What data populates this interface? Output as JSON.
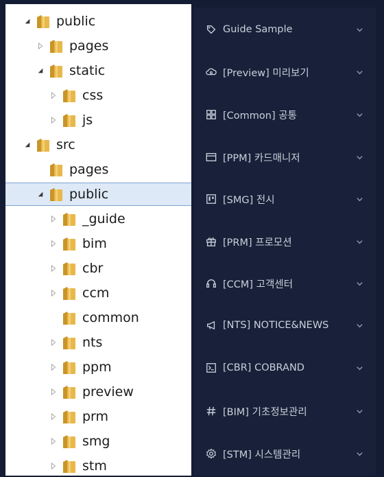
{
  "file_tree": {
    "nodes": [
      {
        "label": "public",
        "depth": 0,
        "toggle": "expanded"
      },
      {
        "label": "pages",
        "depth": 1,
        "toggle": "collapsed"
      },
      {
        "label": "static",
        "depth": 1,
        "toggle": "expanded"
      },
      {
        "label": "css",
        "depth": 2,
        "toggle": "collapsed"
      },
      {
        "label": "js",
        "depth": 2,
        "toggle": "collapsed"
      },
      {
        "label": "src",
        "depth": 0,
        "toggle": "expanded"
      },
      {
        "label": "pages",
        "depth": 1,
        "toggle": "none"
      },
      {
        "label": "public",
        "depth": 1,
        "toggle": "expanded",
        "selected": true
      },
      {
        "label": "_guide",
        "depth": 2,
        "toggle": "collapsed"
      },
      {
        "label": "bim",
        "depth": 2,
        "toggle": "collapsed"
      },
      {
        "label": "cbr",
        "depth": 2,
        "toggle": "collapsed"
      },
      {
        "label": "ccm",
        "depth": 2,
        "toggle": "collapsed"
      },
      {
        "label": "common",
        "depth": 2,
        "toggle": "none"
      },
      {
        "label": "nts",
        "depth": 2,
        "toggle": "collapsed"
      },
      {
        "label": "ppm",
        "depth": 2,
        "toggle": "collapsed"
      },
      {
        "label": "preview",
        "depth": 2,
        "toggle": "collapsed"
      },
      {
        "label": "prm",
        "depth": 2,
        "toggle": "collapsed"
      },
      {
        "label": "smg",
        "depth": 2,
        "toggle": "collapsed"
      },
      {
        "label": "stm",
        "depth": 2,
        "toggle": "collapsed"
      }
    ]
  },
  "side_menu": {
    "items": [
      {
        "label": "Guide Sample",
        "icon": "tag-icon"
      },
      {
        "label": "[Preview] 미리보기",
        "icon": "cloud-icon"
      },
      {
        "label": "[Common] 공통",
        "icon": "grid-icon"
      },
      {
        "label": "[PPM] 카드매니저",
        "icon": "card-icon"
      },
      {
        "label": "[SMG] 전시",
        "icon": "board-icon"
      },
      {
        "label": "[PRM] 프로모션",
        "icon": "gift-icon"
      },
      {
        "label": "[CCM] 고객센터",
        "icon": "headset-icon"
      },
      {
        "label": "[NTS] NOTICE&NEWS",
        "icon": "megaphone-icon"
      },
      {
        "label": "[CBR] COBRAND",
        "icon": "terminal-icon"
      },
      {
        "label": "[BIM] 기초정보관리",
        "icon": "hash-icon"
      },
      {
        "label": "[STM] 시스템관리",
        "icon": "gear-icon"
      }
    ]
  },
  "colors": {
    "folder": "#e8b84a",
    "selection": "#dde9f6",
    "menu_bg": "#182139",
    "menu_text": "#c9cfdc"
  }
}
